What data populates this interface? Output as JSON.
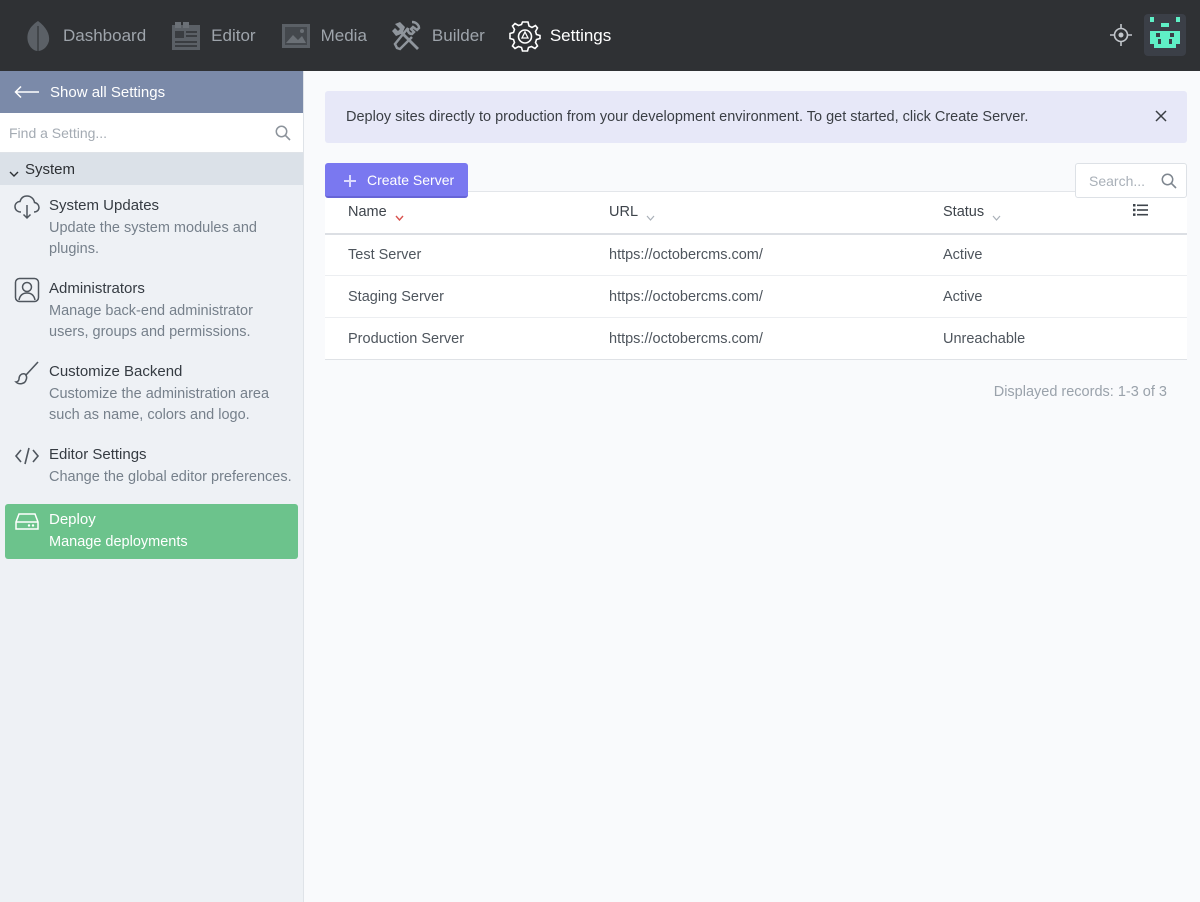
{
  "nav": {
    "items": [
      {
        "label": "Dashboard",
        "icon": "leaf-icon"
      },
      {
        "label": "Editor",
        "icon": "editor-icon"
      },
      {
        "label": "Media",
        "icon": "media-icon"
      },
      {
        "label": "Builder",
        "icon": "wrench-icon"
      },
      {
        "label": "Settings",
        "icon": "gear-icon",
        "active": true
      }
    ]
  },
  "sidebar": {
    "back_label": "Show all Settings",
    "find_placeholder": "Find a Setting...",
    "group_label": "System",
    "items": [
      {
        "title": "System Updates",
        "desc": "Update the system modules and plugins.",
        "icon": "cloud-download-icon"
      },
      {
        "title": "Administrators",
        "desc": "Manage back-end administrator users, groups and permissions.",
        "icon": "user-icon"
      },
      {
        "title": "Customize Backend",
        "desc": "Customize the administration area such as name, colors and logo.",
        "icon": "brush-icon"
      },
      {
        "title": "Editor Settings",
        "desc": "Change the global editor preferences.",
        "icon": "code-icon"
      },
      {
        "title": "Deploy",
        "desc": "Manage deployments",
        "icon": "hard-drive-icon",
        "active": true
      }
    ]
  },
  "alert": {
    "text": "Deploy sites directly to production from your development environment. To get started, click Create Server."
  },
  "toolbar": {
    "create_label": "Create Server",
    "search_placeholder": "Search..."
  },
  "table": {
    "headers": [
      "Name",
      "URL",
      "Status"
    ],
    "rows": [
      {
        "name": "Test Server",
        "url": "https://octobercms.com/",
        "status": "Active"
      },
      {
        "name": "Staging Server",
        "url": "https://octobercms.com/",
        "status": "Active"
      },
      {
        "name": "Production Server",
        "url": "https://octobercms.com/",
        "status": "Unreachable"
      }
    ]
  },
  "records_label": "Displayed records: 1-3 of 3",
  "colors": {
    "topbar": "#2f3134",
    "accent": "#7a78f0",
    "active_item": "#6cc38c",
    "back_bar": "#7b8aa9",
    "sort_active": "#d9534f"
  }
}
